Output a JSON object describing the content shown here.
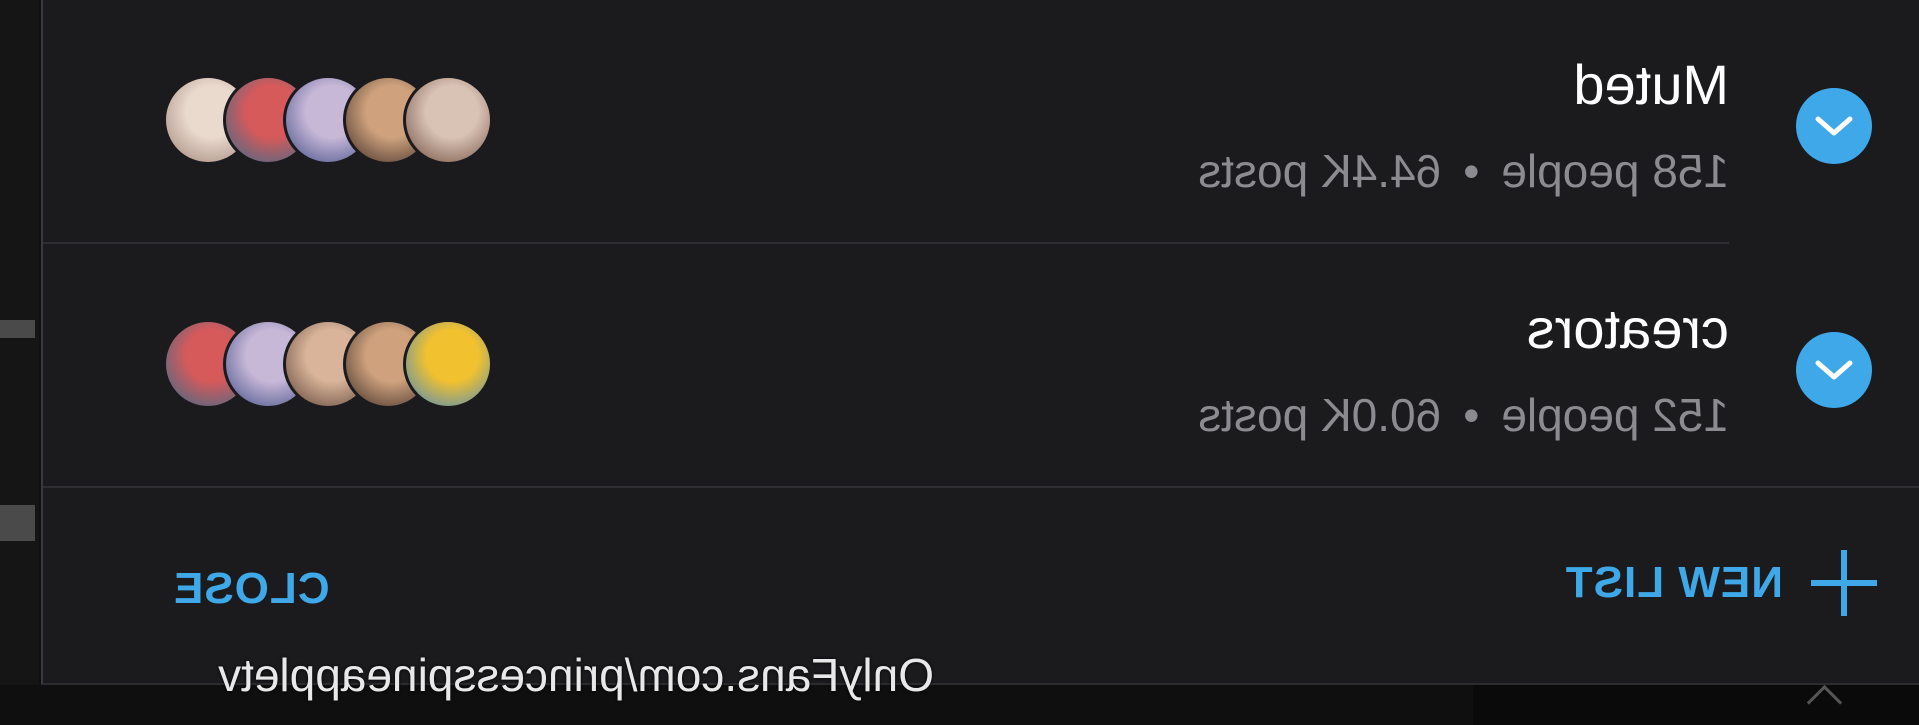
{
  "lists": [
    {
      "title": "Muted",
      "people": "158 people",
      "separator": "•",
      "posts": "64.4K posts",
      "avatars": [
        {
          "name": "avatar-1",
          "colors": [
            "#d9c3b5",
            "#6d4a3c"
          ]
        },
        {
          "name": "avatar-2",
          "colors": [
            "#cfa27d",
            "#3b2a26"
          ]
        },
        {
          "name": "avatar-3",
          "colors": [
            "#c8b8d8",
            "#3d4b84"
          ]
        },
        {
          "name": "avatar-4",
          "colors": [
            "#d65a5a",
            "#2f6c8f"
          ]
        },
        {
          "name": "avatar-5",
          "colors": [
            "#ead9cd",
            "#9c8275"
          ]
        }
      ]
    },
    {
      "title": "creators",
      "people": "152 people",
      "separator": "•",
      "posts": "60.0K posts",
      "avatars": [
        {
          "name": "avatar-1",
          "colors": [
            "#f1c12f",
            "#3e86c9"
          ]
        },
        {
          "name": "avatar-2",
          "colors": [
            "#cfa27d",
            "#3b2a26"
          ]
        },
        {
          "name": "avatar-3",
          "colors": [
            "#d9b49a",
            "#5a4035"
          ]
        },
        {
          "name": "avatar-4",
          "colors": [
            "#c8b8d8",
            "#3d4b84"
          ]
        },
        {
          "name": "avatar-5",
          "colors": [
            "#d65a5a",
            "#2f6c8f"
          ]
        }
      ]
    }
  ],
  "footer": {
    "new_list_label": "NEW LIST",
    "close_label": "CLOSE"
  },
  "watermark": "OnlyFans.com/princesspineappletv",
  "colors": {
    "accent": "#3fa8e8",
    "background": "#1b1b1e",
    "title": "#ffffff",
    "meta": "#8b8b90"
  },
  "icons": {
    "check": "check-circle-icon",
    "plus": "plus-icon"
  }
}
